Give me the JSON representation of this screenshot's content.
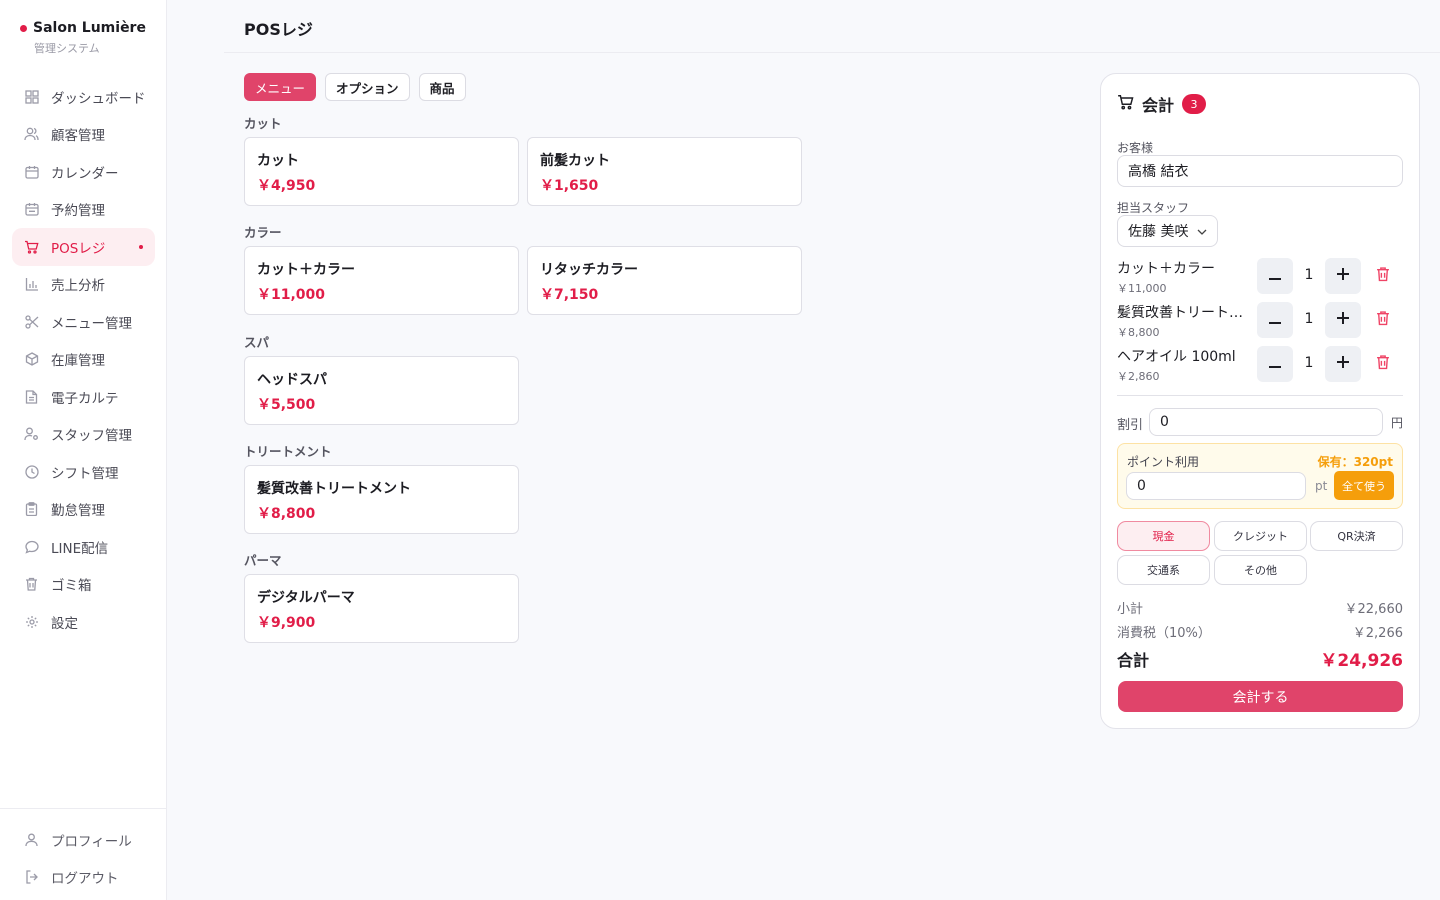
{
  "brand": {
    "name": "Salon Lumière",
    "sub": "管理システム",
    "accent": "#e11d48"
  },
  "sidebar": {
    "items": [
      {
        "label": "ダッシュボード",
        "icon": "dashboard-icon"
      },
      {
        "label": "顧客管理",
        "icon": "users-icon"
      },
      {
        "label": "カレンダー",
        "icon": "calendar-icon"
      },
      {
        "label": "予約管理",
        "icon": "calendar-check-icon"
      },
      {
        "label": "POSレジ",
        "icon": "cart-icon",
        "active": true
      },
      {
        "label": "売上分析",
        "icon": "bar-chart-icon"
      },
      {
        "label": "メニュー管理",
        "icon": "scissors-icon"
      },
      {
        "label": "在庫管理",
        "icon": "box-icon"
      },
      {
        "label": "電子カルテ",
        "icon": "file-text-icon"
      },
      {
        "label": "スタッフ管理",
        "icon": "user-cog-icon"
      },
      {
        "label": "シフト管理",
        "icon": "clock-icon"
      },
      {
        "label": "勤怠管理",
        "icon": "clipboard-icon"
      },
      {
        "label": "LINE配信",
        "icon": "message-icon"
      },
      {
        "label": "ゴミ箱",
        "icon": "trash-icon"
      },
      {
        "label": "設定",
        "icon": "gear-icon"
      }
    ],
    "bottom": [
      {
        "label": "プロフィール",
        "icon": "user-icon"
      },
      {
        "label": "ログアウト",
        "icon": "logout-icon"
      }
    ]
  },
  "header": {
    "title": "POSレジ"
  },
  "tabs": [
    {
      "label": "メニュー",
      "active": true
    },
    {
      "label": "オプション"
    },
    {
      "label": "商品"
    }
  ],
  "categories": [
    {
      "label": "カット",
      "items": [
        {
          "name": "カット",
          "price": "￥4,950"
        },
        {
          "name": "前髪カット",
          "price": "￥1,650"
        }
      ]
    },
    {
      "label": "カラー",
      "items": [
        {
          "name": "カット＋カラー",
          "price": "￥11,000"
        },
        {
          "name": "リタッチカラー",
          "price": "￥7,150"
        }
      ]
    },
    {
      "label": "スパ",
      "items": [
        {
          "name": "ヘッドスパ",
          "price": "￥5,500"
        }
      ]
    },
    {
      "label": "トリートメント",
      "items": [
        {
          "name": "髪質改善トリートメント",
          "price": "￥8,800"
        }
      ]
    },
    {
      "label": "パーマ",
      "items": [
        {
          "name": "デジタルパーマ",
          "price": "￥9,900"
        }
      ]
    }
  ],
  "checkout": {
    "title": "会計",
    "count": "3",
    "customer_label": "お客様",
    "customer_value": "高橋 結衣",
    "staff_label": "担当スタッフ",
    "staff_value": "佐藤 美咲",
    "lines": [
      {
        "name": "カット＋カラー",
        "price": "￥11,000",
        "qty": "1"
      },
      {
        "name": "髪質改善トリートメント",
        "price": "￥8,800",
        "qty": "1"
      },
      {
        "name": "ヘアオイル 100ml",
        "price": "￥2,860",
        "qty": "1"
      }
    ],
    "discount_label": "割引",
    "discount_value": "0",
    "discount_unit": "円",
    "points_title": "ポイント利用",
    "points_held": "保有：320pt",
    "points_value": "0",
    "points_unit": "pt",
    "points_use_all": "全て使う",
    "payment_methods": [
      {
        "label": "現金",
        "active": true
      },
      {
        "label": "クレジット"
      },
      {
        "label": "QR決済"
      },
      {
        "label": "交通系"
      },
      {
        "label": "その他"
      }
    ],
    "subtotal_label": "小計",
    "subtotal_value": "￥22,660",
    "tax_label": "消費税（10%）",
    "tax_value": "￥2,266",
    "total_label": "合計",
    "total_value": "￥24,926",
    "submit_label": "会計する"
  }
}
